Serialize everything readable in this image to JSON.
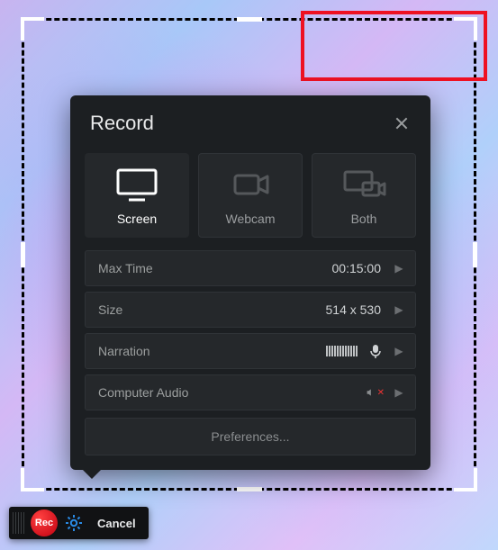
{
  "panel": {
    "title": "Record",
    "modes": {
      "screen": "Screen",
      "webcam": "Webcam",
      "both": "Both"
    },
    "rows": {
      "maxtime": {
        "label": "Max Time",
        "value": "00:15:00"
      },
      "size": {
        "label": "Size",
        "value": "514 x 530"
      },
      "narration": {
        "label": "Narration"
      },
      "audio": {
        "label": "Computer Audio"
      }
    },
    "preferences": "Preferences..."
  },
  "toolbar": {
    "rec": "Rec",
    "cancel": "Cancel"
  },
  "icons": {
    "close": "close-icon",
    "screen": "monitor-icon",
    "webcam": "camera-icon",
    "both": "dual-icon",
    "mic": "microphone-icon",
    "speaker": "speaker-muted-icon",
    "caret": "chevron-right-icon",
    "gear": "gear-icon"
  }
}
